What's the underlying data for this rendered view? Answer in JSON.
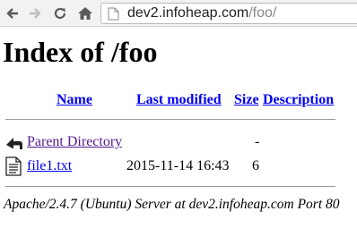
{
  "browser": {
    "url_host": "dev2.infoheap.com",
    "url_path": "/foo/",
    "icons": [
      "back-arrow-icon",
      "forward-arrow-icon",
      "reload-icon",
      "home-icon",
      "page-icon"
    ]
  },
  "page": {
    "title": "Index of /foo",
    "columns": {
      "name": "Name",
      "last_modified": "Last modified",
      "size": "Size",
      "description": "Description"
    },
    "rows": [
      {
        "icon": "back-folder-icon",
        "name": "Parent Directory",
        "last_modified": "",
        "size": "-",
        "description": ""
      },
      {
        "icon": "text-file-icon",
        "name": "file1.txt",
        "last_modified": "2015-11-14 16:43",
        "size": "6",
        "description": ""
      }
    ],
    "server_signature": "Apache/2.4.7 (Ubuntu) Server at dev2.infoheap.com Port 80"
  },
  "colors": {
    "link": "#0000ee",
    "visited_link": "#551a8b",
    "rule": "#9a9a9a"
  }
}
